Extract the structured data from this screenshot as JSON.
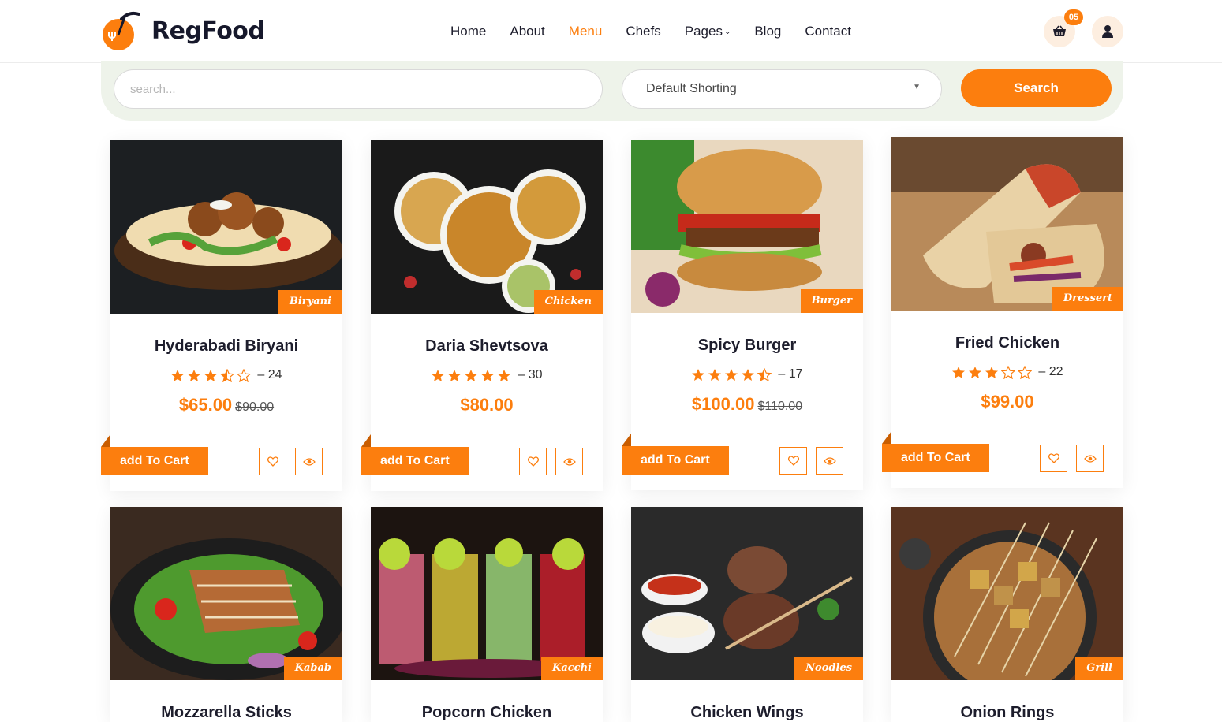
{
  "brand": {
    "name": "RegFood"
  },
  "nav": {
    "items": [
      {
        "label": "Home",
        "active": false
      },
      {
        "label": "About",
        "active": false
      },
      {
        "label": "Menu",
        "active": true
      },
      {
        "label": "Chefs",
        "active": false
      },
      {
        "label": "Pages",
        "active": false,
        "dropdown": true
      },
      {
        "label": "Blog",
        "active": false
      },
      {
        "label": "Contact",
        "active": false
      }
    ]
  },
  "header": {
    "cart_count": "05",
    "cart_icon": "basket-icon",
    "user_icon": "user-icon"
  },
  "search": {
    "placeholder": "search...",
    "sort_value": "Default Shorting",
    "button_label": "Search"
  },
  "colors": {
    "accent": "#fc7e0e",
    "search_bg": "#eef3ea",
    "text": "#1d1d2c"
  },
  "products": [
    {
      "name": "Hyderabadi Biryani",
      "category": "Biryani",
      "rating": 3.5,
      "reviews": "24",
      "price": "$65.00",
      "old_price": "$90.00",
      "cart_label": "add To Cart"
    },
    {
      "name": "Daria Shevtsova",
      "category": "Chicken",
      "rating": 5,
      "reviews": "30",
      "price": "$80.00",
      "old_price": "",
      "cart_label": "add To Cart"
    },
    {
      "name": "Spicy Burger",
      "category": "Burger",
      "rating": 4.5,
      "reviews": "17",
      "price": "$100.00",
      "old_price": "$110.00",
      "cart_label": "add To Cart"
    },
    {
      "name": "Fried Chicken",
      "category": "Dressert",
      "rating": 3,
      "reviews": "22",
      "price": "$99.00",
      "old_price": "",
      "cart_label": "add To Cart"
    },
    {
      "name": "Mozzarella Sticks",
      "category": "Kabab"
    },
    {
      "name": "Popcorn Chicken",
      "category": "Kacchi"
    },
    {
      "name": "Chicken Wings",
      "category": "Noodles"
    },
    {
      "name": "Onion Rings",
      "category": "Grill"
    }
  ]
}
